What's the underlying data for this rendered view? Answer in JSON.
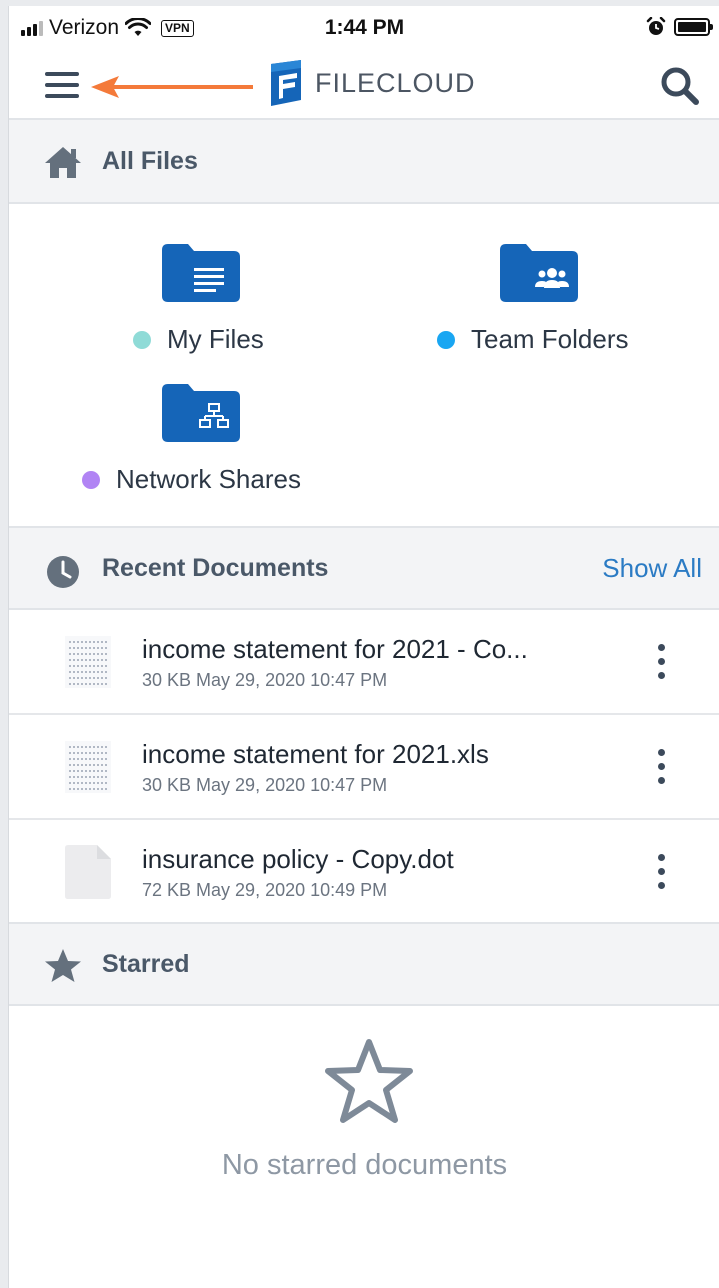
{
  "status_bar": {
    "carrier": "Verizon",
    "vpn": "VPN",
    "time": "1:44 PM"
  },
  "header": {
    "logo_text": "FILECLOUD",
    "menu_icon": "hamburger-icon",
    "search_icon": "search-icon",
    "annotation_arrow_color": "#f47a3a"
  },
  "all_files": {
    "title": "All Files",
    "icon": "home-icon",
    "folders": [
      {
        "label": "My Files",
        "dot_color": "#8fdbd7",
        "icon": "document-folder-icon"
      },
      {
        "label": "Team Folders",
        "dot_color": "#19a6f2",
        "icon": "team-folder-icon"
      },
      {
        "label": "Network Shares",
        "dot_color": "#b184f4",
        "icon": "network-folder-icon"
      }
    ]
  },
  "recent": {
    "title": "Recent Documents",
    "icon": "clock-icon",
    "show_all": "Show All",
    "items": [
      {
        "name": "income statement for 2021 - Co...",
        "meta": "30 KB May 29, 2020 10:47 PM",
        "thumb": "spreadsheet-thumbnail"
      },
      {
        "name": "income statement for 2021.xls",
        "meta": "30 KB May 29, 2020 10:47 PM",
        "thumb": "spreadsheet-thumbnail"
      },
      {
        "name": "insurance policy - Copy.dot",
        "meta": "72 KB May 29, 2020 10:49 PM",
        "thumb": "blank-file-icon"
      }
    ]
  },
  "starred": {
    "title": "Starred",
    "icon": "star-icon",
    "empty_text": "No starred documents"
  },
  "colors": {
    "brand_blue": "#1565b8",
    "link_blue": "#2b7bc4"
  }
}
